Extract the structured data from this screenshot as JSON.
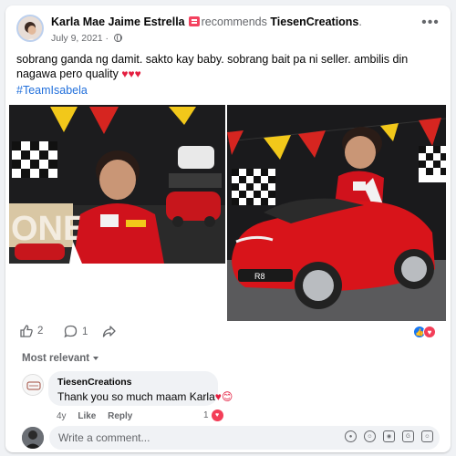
{
  "post": {
    "author": "Karla Mae Jaime Estrella",
    "recommends_text": "recommends",
    "page": "TiesenCreations",
    "page_suffix": ".",
    "date": "July 9, 2021",
    "date_separator": "·",
    "text": "sobrang ganda ng damit. sakto kay baby. sobrang bait pa ni seller. ambilis din nagawa pero quality",
    "text_emoji": "♥♥♥",
    "hashtag": "#TeamIsabela",
    "more_icon": "more-horizontal-icon"
  },
  "photos": {
    "left_banner_letters": "ONE",
    "car_plate_text": "R8"
  },
  "actions": {
    "like_count": "2",
    "comment_count": "1",
    "reactions": [
      "like-icon",
      "love-icon"
    ]
  },
  "comments": {
    "sort_label": "Most relevant",
    "items": [
      {
        "name": "TiesenCreations",
        "text": "Thank you so much maam Karla",
        "emoji": "♥😊",
        "age": "4y",
        "like_label": "Like",
        "reply_label": "Reply",
        "reaction_count": "1"
      }
    ]
  },
  "composer": {
    "placeholder": "Write a comment...",
    "icons": [
      "avatar-icon",
      "emoji-icon",
      "camera-icon",
      "gif-icon",
      "sticker-icon"
    ]
  },
  "colors": {
    "link": "#216fdb",
    "like_blue": "#1877f2",
    "love_red": "#f33e58",
    "car_red": "#d8141a"
  }
}
